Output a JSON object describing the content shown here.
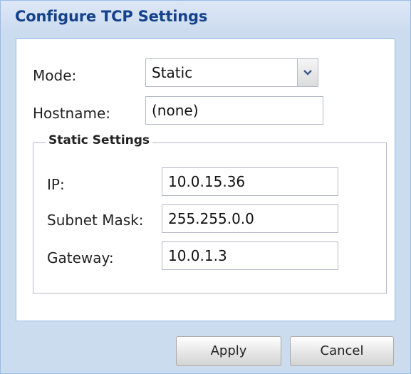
{
  "dialog": {
    "title": "Configure TCP Settings"
  },
  "form": {
    "mode": {
      "label": "Mode:",
      "value": "Static"
    },
    "hostname": {
      "label": "Hostname:",
      "value": "(none)"
    }
  },
  "static_settings": {
    "legend": "Static Settings",
    "ip": {
      "label": "IP:",
      "value": "10.0.15.36"
    },
    "subnet_mask": {
      "label": "Subnet Mask:",
      "value": "255.255.0.0"
    },
    "gateway": {
      "label": "Gateway:",
      "value": "10.0.1.3"
    }
  },
  "buttons": {
    "apply": "Apply",
    "cancel": "Cancel"
  },
  "icons": {
    "dropdown": "chevron-down-icon"
  },
  "colors": {
    "title_text": "#15428b",
    "dialog_background": "#ccdcef",
    "border": "#99bbe8"
  }
}
